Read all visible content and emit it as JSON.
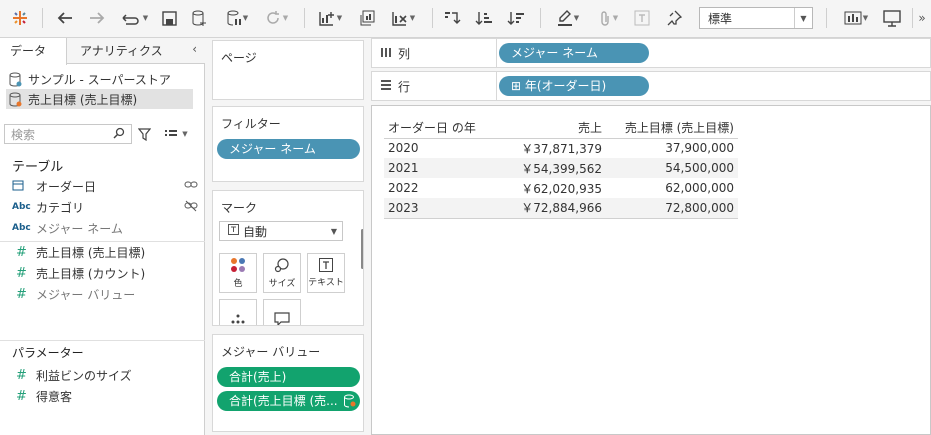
{
  "toolbar": {
    "fit_value": "標準"
  },
  "datapane": {
    "tab_data": "データ",
    "tab_analytics": "アナリティクス",
    "collapse": "‹",
    "datasources": [
      {
        "label": "サンプル - スーパーストア"
      },
      {
        "label": "売上目標 (売上目標)"
      }
    ],
    "search_placeholder": "検索",
    "tables_title": "テーブル",
    "fields": [
      {
        "type": "date",
        "label": "オーダー日"
      },
      {
        "type": "Abc",
        "label": "カテゴリ"
      },
      {
        "type": "Abc",
        "label": "メジャー ネーム"
      },
      {
        "type": "#",
        "label": "売上目標 (売上目標)"
      },
      {
        "type": "#",
        "label": "売上目標 (カウント)"
      },
      {
        "type": "#",
        "label": "メジャー バリュー"
      }
    ],
    "parameters_title": "パラメーター",
    "parameters": [
      {
        "label": "利益ビンのサイズ"
      },
      {
        "label": "得意客"
      }
    ]
  },
  "shelves": {
    "pages_title": "ページ",
    "filters_title": "フィルター",
    "filter_pill": "メジャー ネーム",
    "marks_title": "マーク",
    "marks_type": "自動",
    "mark_color": "色",
    "mark_size": "サイズ",
    "mark_text": "テキスト",
    "measure_values_title": "メジャー バリュー",
    "mv_pills": [
      "合計(売上)",
      "合計(売上目標 (売..."
    ],
    "columns_label": "列",
    "columns_pill": "メジャー ネーム",
    "rows_label": "行",
    "rows_pill": "⊞ 年(オーダー日)"
  },
  "view": {
    "headers": [
      "オーダー日 の年",
      "売上",
      "売上目標 (売上目標)"
    ],
    "rows": [
      {
        "year": "2020",
        "sales": "￥37,871,379",
        "target": "37,900,000"
      },
      {
        "year": "2021",
        "sales": "￥54,399,562",
        "target": "54,500,000"
      },
      {
        "year": "2022",
        "sales": "￥62,020,935",
        "target": "62,000,000"
      },
      {
        "year": "2023",
        "sales": "￥72,884,966",
        "target": "72,800,000"
      }
    ]
  },
  "colors": {
    "pill_blue": "#4a94b4",
    "pill_green": "#12a36e",
    "type_blue": "#1b5f8c",
    "measure_green": "#25a07a"
  }
}
